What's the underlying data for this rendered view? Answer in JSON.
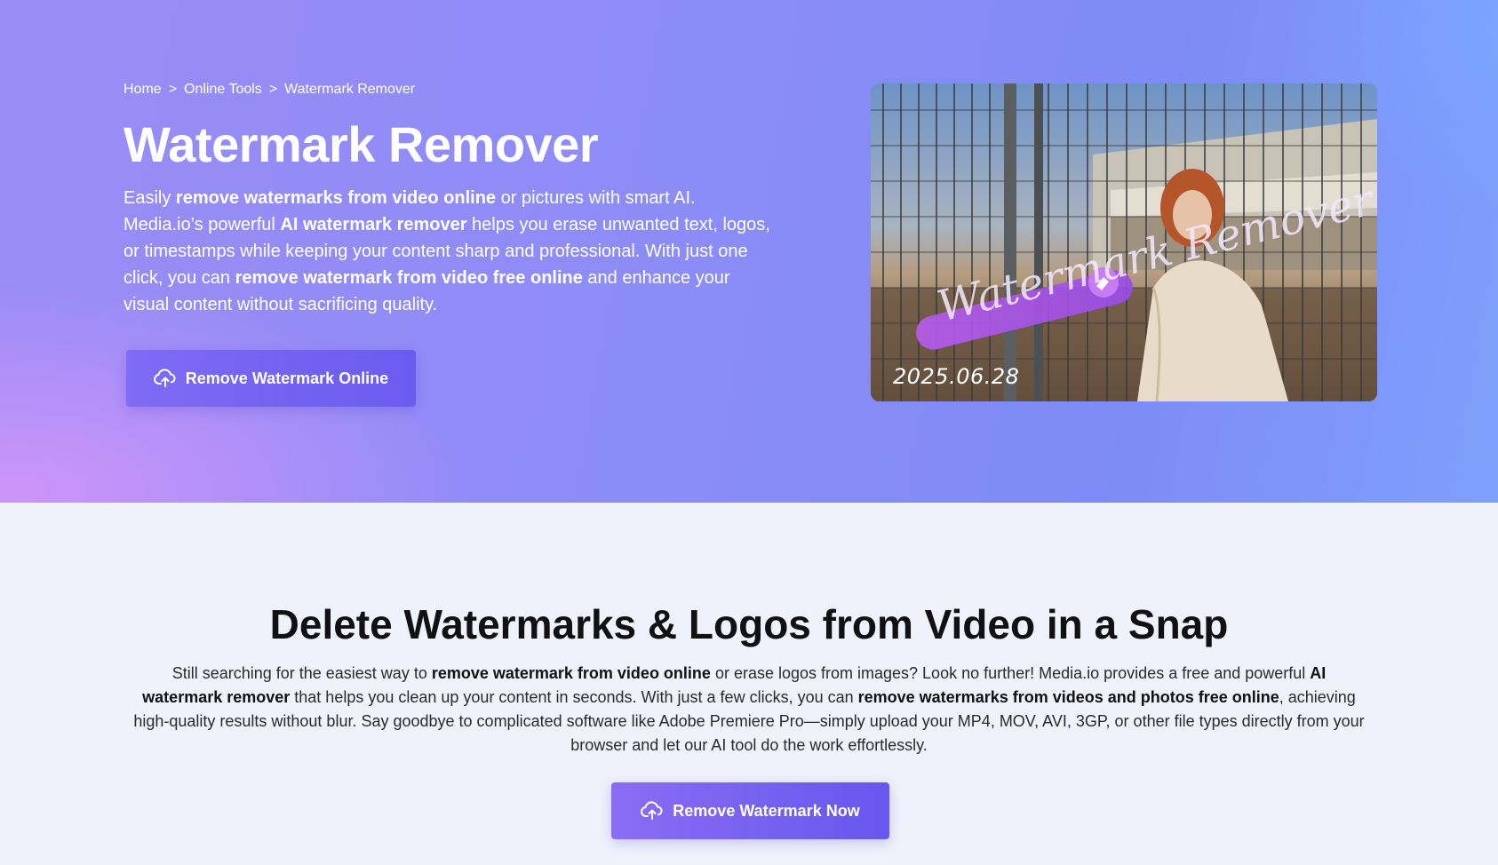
{
  "breadcrumb": {
    "items": [
      "Home",
      "Online Tools",
      "Watermark Remover"
    ],
    "separator": ">"
  },
  "hero": {
    "title": "Watermark Remover",
    "desc": [
      {
        "t": "Easily "
      },
      {
        "t": "remove watermarks from video online",
        "b": true
      },
      {
        "t": " or pictures with smart AI. Media.io’s powerful "
      },
      {
        "t": "AI watermark remover",
        "b": true
      },
      {
        "t": " helps you erase unwanted text, logos, or timestamps while keeping your content sharp and professional. With just one click, you can "
      },
      {
        "t": "remove watermark from video free online",
        "b": true
      },
      {
        "t": " and enhance your visual content without sacrificing quality."
      }
    ],
    "button_label": "Remove Watermark Online",
    "button_icon": "cloud-upload-icon",
    "image": {
      "overlay_text": "Watermark Remover",
      "date_stamp": "2025.06.28"
    }
  },
  "section": {
    "title": "Delete Watermarks & Logos from Video in a Snap",
    "desc": [
      {
        "t": "Still searching for the easiest way to "
      },
      {
        "t": "remove watermark from video online",
        "b": true
      },
      {
        "t": " or erase logos from images? Look no further! Media.io provides a free and powerful "
      },
      {
        "t": "AI watermark remover",
        "b": true
      },
      {
        "t": " that helps you clean up your content in seconds. With just a few clicks, you can "
      },
      {
        "t": "remove watermarks from videos and photos free online",
        "b": true
      },
      {
        "t": ", achieving high-quality results without blur. Say goodbye to complicated software like Adobe Premiere Pro—simply upload your MP4, MOV, AVI, 3GP, or other file types directly from your browser and let our AI tool do the work effortlessly."
      }
    ],
    "button_label": "Remove Watermark Now",
    "button_icon": "cloud-upload-icon"
  },
  "colors": {
    "accent": "#6a5cf0",
    "hero_bg": "#8e8cf7",
    "section_bg": "#eff2fb"
  }
}
